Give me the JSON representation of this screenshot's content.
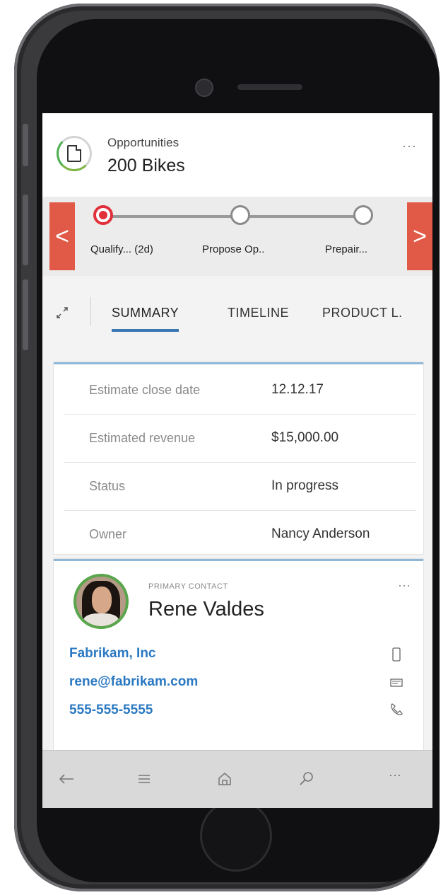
{
  "header": {
    "entity_type": "Opportunities",
    "record_title": "200 Bikes",
    "more_label": "···"
  },
  "process": {
    "stages": [
      {
        "label": "Qualify... (2d)",
        "state": "active"
      },
      {
        "label": "Propose Op..",
        "state": "pending"
      },
      {
        "label": "Prepair...",
        "state": "pending"
      }
    ],
    "prev_label": "<",
    "next_label": ">"
  },
  "tabs": [
    "SUMMARY",
    "TIMELINE",
    "PRODUCT L."
  ],
  "summary": {
    "rows": [
      {
        "key": "Estimate close date",
        "value": "12.12.17"
      },
      {
        "key": "Estimated revenue",
        "value": "$15,000.00"
      },
      {
        "key": "Status",
        "value": "In progress"
      },
      {
        "key": "Owner",
        "value": "Nancy Anderson"
      }
    ]
  },
  "contact": {
    "label": "PRIMARY CONTACT",
    "name": "Rene Valdes",
    "company": "Fabrikam, Inc",
    "email": "rene@fabrikam.com",
    "phone": "555-555-5555",
    "more_label": "···"
  },
  "navbar": {
    "more_label": "···"
  },
  "colors": {
    "accent_blue": "#2b79c2",
    "process_arrow": "#e05a47",
    "active_stage": "#e0303a"
  }
}
